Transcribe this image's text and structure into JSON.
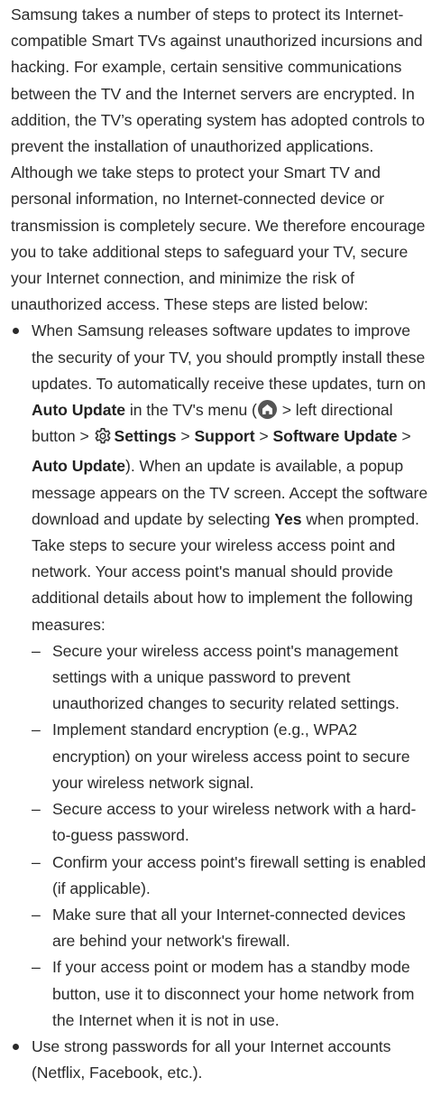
{
  "paragraphs": [
    "Samsung takes a number of steps to protect its Internet-compatible Smart TVs against unauthorized incursions and hacking. For example, certain sensitive communications between the TV and the Internet servers are encrypted. In addition, the TV’s operating system has adopted controls to prevent the installation of unauthorized applications.",
    "Although we take steps to protect your Smart TV and personal information, no Internet-connected device or transmission is completely secure. We therefore encourage you to take additional steps to safeguard your TV, secure your Internet connection, and minimize the risk of unauthorized access. These steps are listed below:"
  ],
  "bullet1": {
    "t1": "When Samsung releases software updates to improve the security of your TV, you should promptly install these updates. To automatically receive these updates, turn on ",
    "b1": "Auto Update",
    "t2": " in the TV's menu (",
    "t3": " > left directional button > ",
    "b2": "Settings",
    "t4": " > ",
    "b3": "Support",
    "t5": " > ",
    "b4": "Software Update",
    "t6": " > ",
    "b5": "Auto Update",
    "t7": "). When an update is available, a popup message appears on the TV screen. Accept the software download and update by selecting ",
    "b6": "Yes",
    "t8": " when prompted. Take steps to secure your wireless access point and network. Your access point's manual should provide additional details about how to implement the following measures:"
  },
  "dash_marker": "–",
  "sub_items": [
    "Secure your wireless access point's management settings with a unique password to prevent unauthorized changes to security related settings.",
    "Implement standard encryption (e.g., WPA2 encryption) on your wireless access point to secure your wireless network signal.",
    "Secure access to your wireless network with a hard-to-guess password.",
    "Confirm your access point's firewall setting is enabled (if applicable).",
    "Make sure that all your Internet-connected devices are behind your network's firewall.",
    "If your access point or modem has a standby mode button, use it to disconnect your home network from the Internet when it is not in use."
  ],
  "bullet2": "Use strong passwords for all your Internet accounts (Netflix, Facebook, etc.).",
  "icons": {
    "home": "home-icon",
    "settings": "gear-icon"
  },
  "colors": {
    "text": "#2b2b2b",
    "icon": "#555555"
  }
}
